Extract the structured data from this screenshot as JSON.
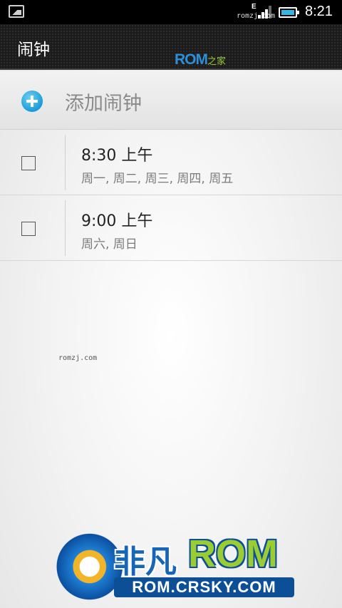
{
  "status_bar": {
    "network_type": "E",
    "watermark": "romzj.com",
    "time": "8:21"
  },
  "action_bar": {
    "title": "闹钟",
    "logo_main": "ROM",
    "logo_sub": "之家"
  },
  "add_alarm": {
    "label": "添加闹钟",
    "icon": "add-circle-icon"
  },
  "alarms": [
    {
      "time": "8:30 上午",
      "days": "周一, 周二, 周三, 周四, 周五",
      "enabled": false
    },
    {
      "time": "9:00 上午",
      "days": "周六, 周日",
      "enabled": false
    }
  ],
  "overlay": {
    "watermark": "romzj.com",
    "brand_cn": "非凡",
    "brand_rom": "ROM",
    "brand_url": "ROM.CRSKY.COM"
  },
  "colors": {
    "accent": "#33b5e5",
    "add_icon": "#1a9bd8",
    "brand_blue": "#0d4f96",
    "brand_green": "#9acd32"
  }
}
